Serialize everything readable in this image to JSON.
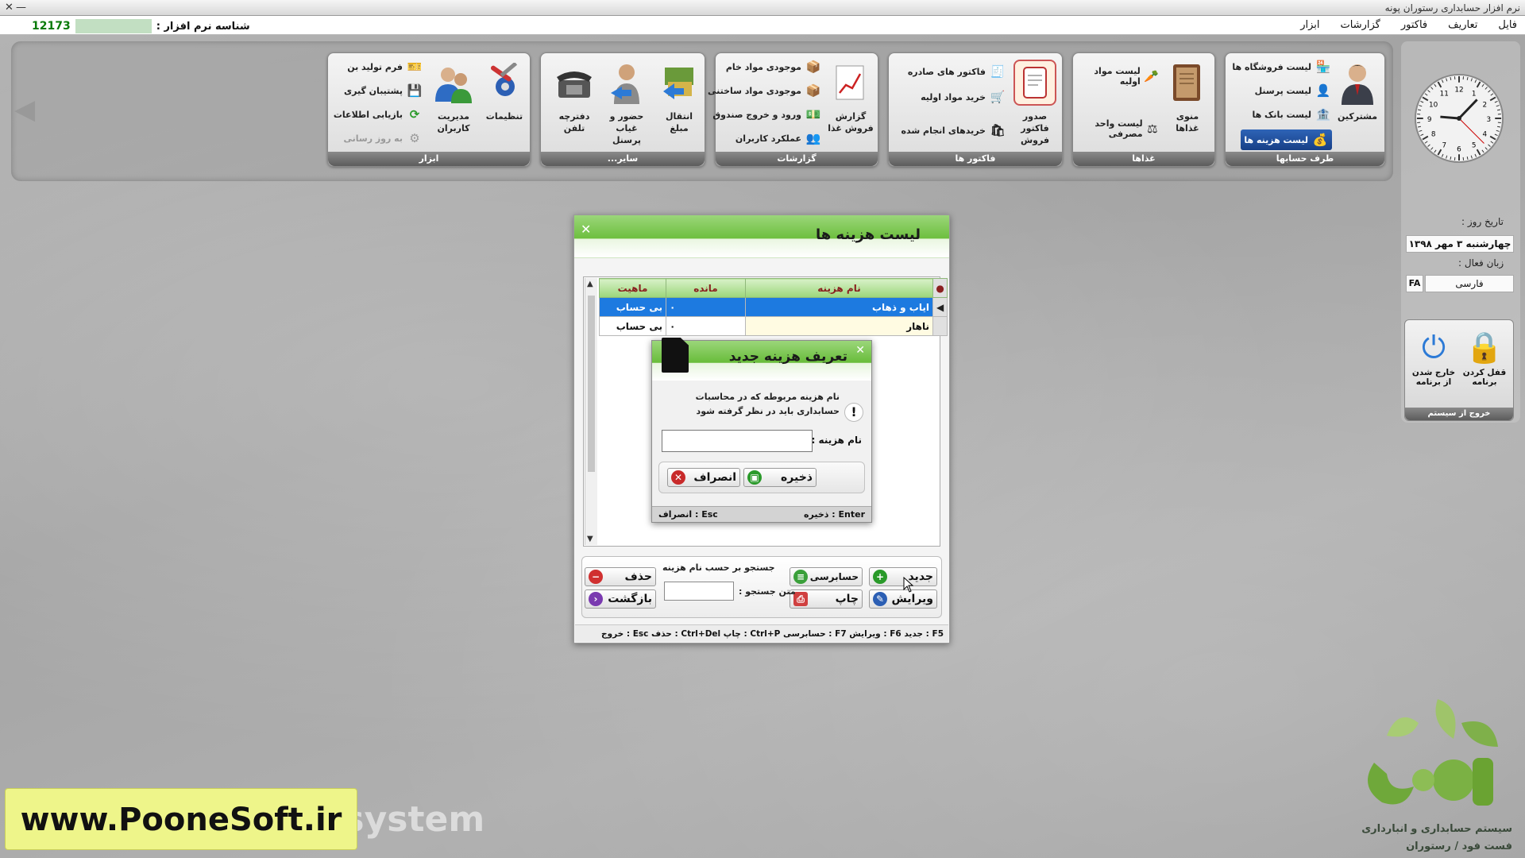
{
  "window": {
    "title": "نرم افزار حسابداری رستوران پونه",
    "minimize": "—",
    "close": "✕"
  },
  "menu": [
    "فایل",
    "تعاریف",
    "فاکتور",
    "گزارشات",
    "ابزار"
  ],
  "system_id": {
    "label": "شناسه نرم افزار :",
    "value": "12173"
  },
  "ribbon": {
    "accounts": {
      "title": "طرف حسابها",
      "big_label": "مشترکین",
      "items": [
        "لیست فروشگاه ها",
        "لیست پرسنل",
        "لیست بانک ها",
        "لیست هزینه ها"
      ]
    },
    "foods": {
      "title": "غذاها",
      "big_label": "منوی غذاها",
      "items": [
        "لیست مواد اولیه",
        "لیست واحد مصرفی"
      ]
    },
    "invoices": {
      "title": "فاکتور ها",
      "big_label": "صدور فاکتور فروش",
      "items": [
        "فاکتور های صادره",
        "خرید مواد اولیه",
        "خریدهای انجام شده"
      ]
    },
    "reports": {
      "title": "گزارشات",
      "big_label": "گزارش فروش غذا",
      "items": [
        "موجودی مواد خام",
        "موجودی مواد ساختنی",
        "ورود و خروج صندوق",
        "عملکرد کاربران"
      ]
    },
    "other": {
      "title": "سایر...",
      "buttons": [
        "انتقال مبلغ",
        "حضور و غیاب پرسنل",
        "دفترچه تلفن"
      ]
    },
    "tools": {
      "title": "ابزار",
      "buttons": [
        "تنظیمات",
        "مدیریت کاربران"
      ],
      "items": [
        "فرم تولید بن",
        "پشتیبان گیری",
        "بازیابی اطلاعات",
        "به روز رسانی"
      ]
    }
  },
  "side": {
    "date_label": "تاریخ روز :",
    "date_value": "چهارشنبه ۳ مهر ۱۳۹۸",
    "lang_label": "زبان فعال :",
    "lang_value": "فارسی",
    "lang_code": "FA",
    "exit_title": "خروج از سیستم",
    "lock_label": "قفل کردن برنامه",
    "logout_label": "خارج شدن از برنامه",
    "clock_numbers": [
      "12",
      "1",
      "2",
      "3",
      "4",
      "5",
      "6",
      "7",
      "8",
      "9",
      "10",
      "11"
    ]
  },
  "expense_dialog": {
    "title": "لیست هزینه ها",
    "columns": [
      "نام هزینه",
      "مانده",
      "ماهیت"
    ],
    "rows": [
      {
        "name": "ایاب و ذهاب",
        "balance": "۰",
        "nature": "بی حساب"
      },
      {
        "name": "ناهار",
        "balance": "۰",
        "nature": "بی حساب"
      }
    ],
    "search_title": "جستجو بر حسب نام هزینه",
    "search_label": "متن جستجو :",
    "buttons": {
      "new": "جدید",
      "audit": "حسابرسی",
      "delete": "حذف",
      "edit": "ویرایش",
      "print": "چاپ",
      "back": "بازگشت"
    },
    "shortcuts": "F5 : جدید   F6 : ویرایش   F7 : حسابرسی   Ctrl+P : چاپ   Ctrl+Del : حذف   Esc : خروج"
  },
  "new_expense_dialog": {
    "title": "تعریف هزینه جدید",
    "message": "نام هزینه مربوطه که در محاسبات حسابداری باید در نظر گرفته شود",
    "field_label": "نام هزینه :",
    "field_value": "",
    "save": "ذخیره",
    "cancel": "انصراف",
    "status_save": "Enter : ذخیره",
    "status_cancel": "Esc : انصراف"
  },
  "watermark": {
    "site": "www.PooneSoft.ir",
    "overlay": "nik.system"
  },
  "logo": {
    "brand": "پونه",
    "tagline1": "سیستم حسابداری و انبارداری",
    "tagline2": "فست فود / رستوران"
  },
  "colors": {
    "header_green": "#6dbf3e",
    "selection_blue": "#1d7ae0",
    "banner_yellow": "#eef58a"
  }
}
